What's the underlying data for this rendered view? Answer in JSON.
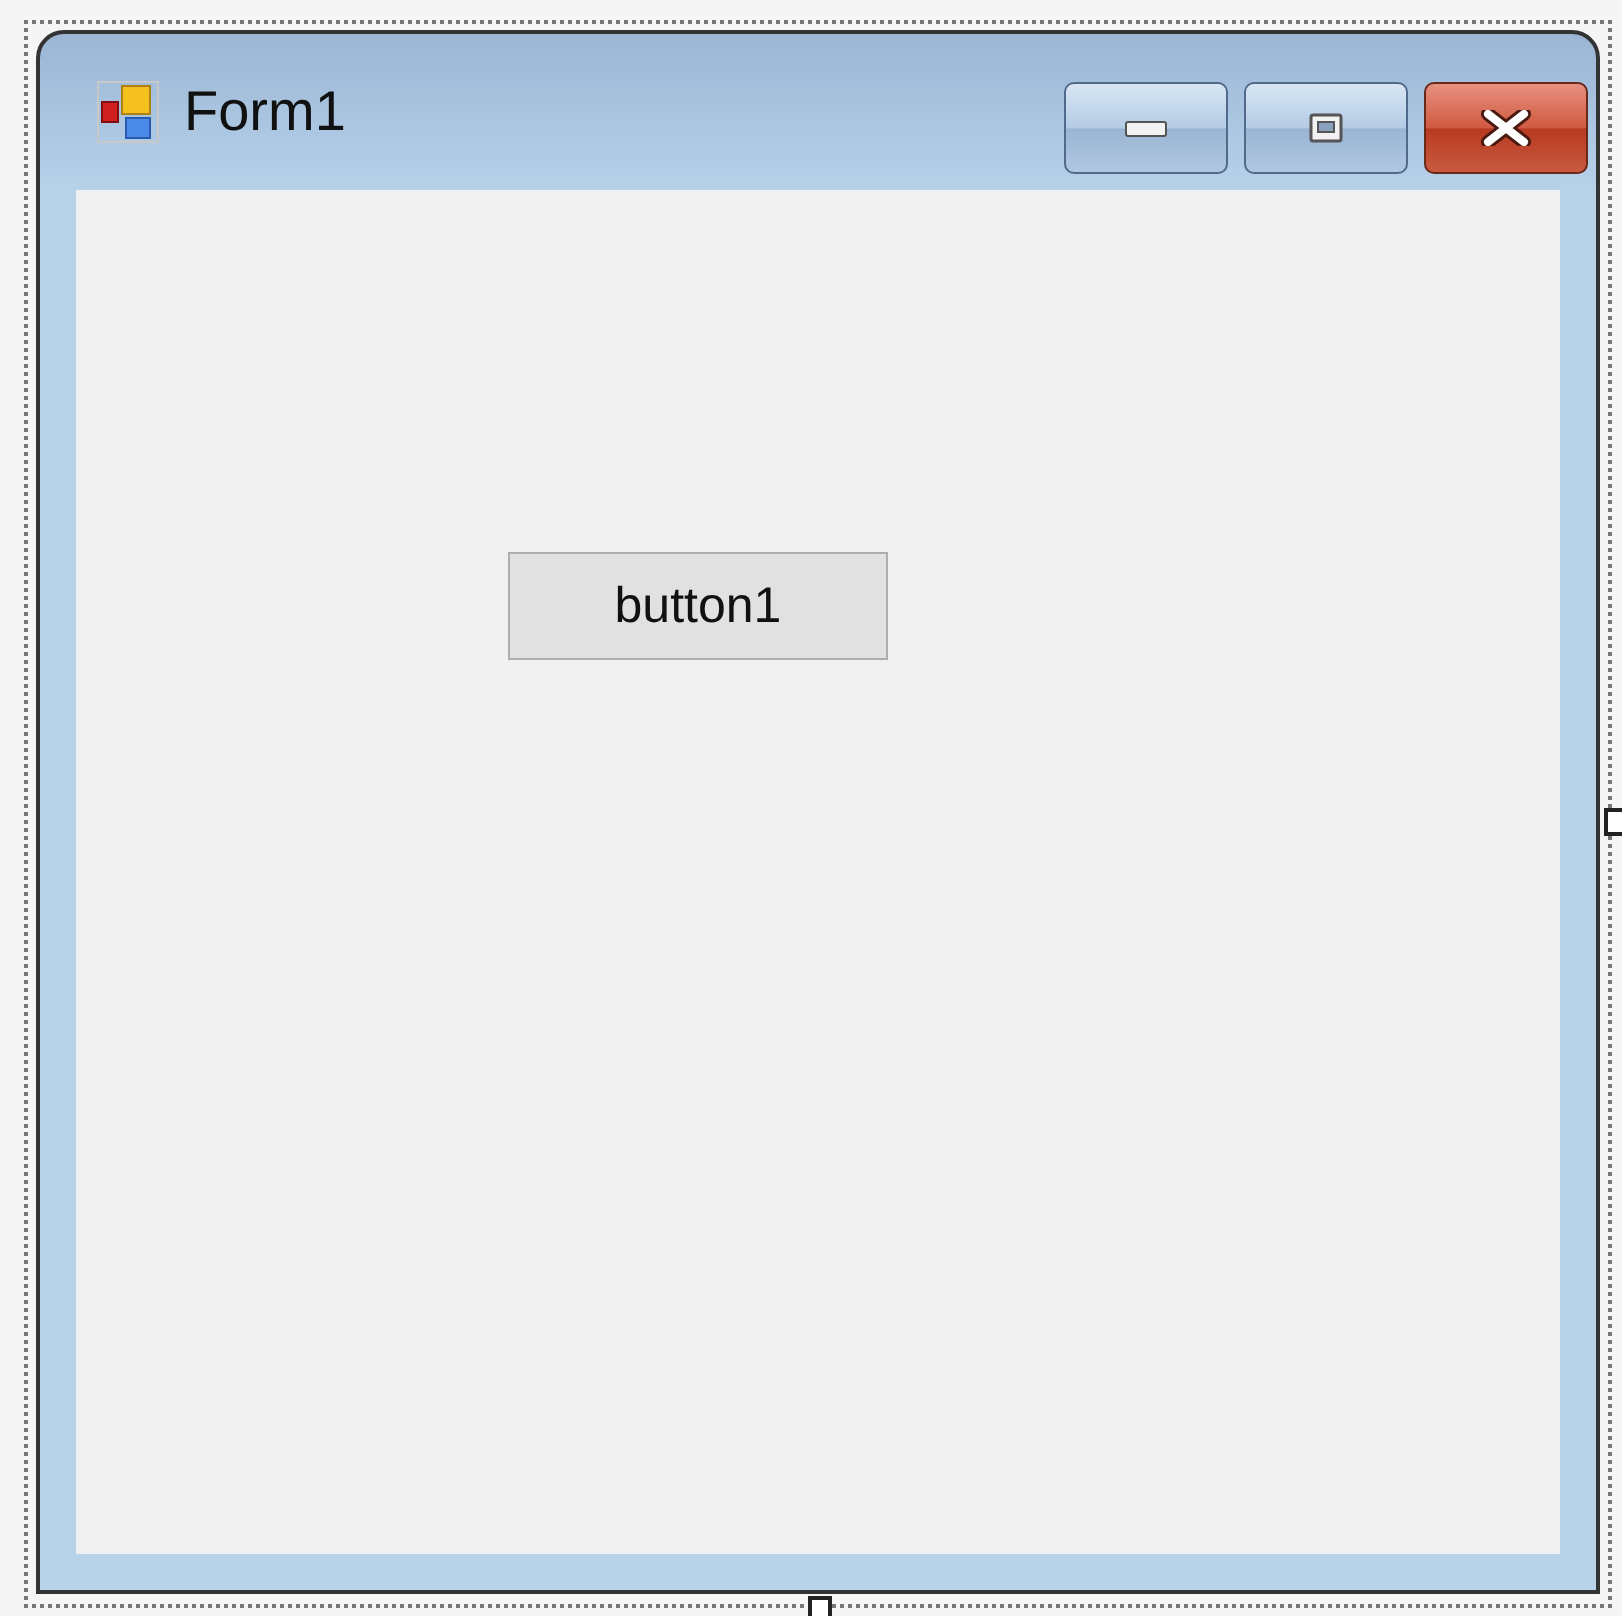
{
  "window": {
    "title": "Form1"
  },
  "controls": [
    {
      "kind": "button",
      "label": "button1"
    }
  ]
}
